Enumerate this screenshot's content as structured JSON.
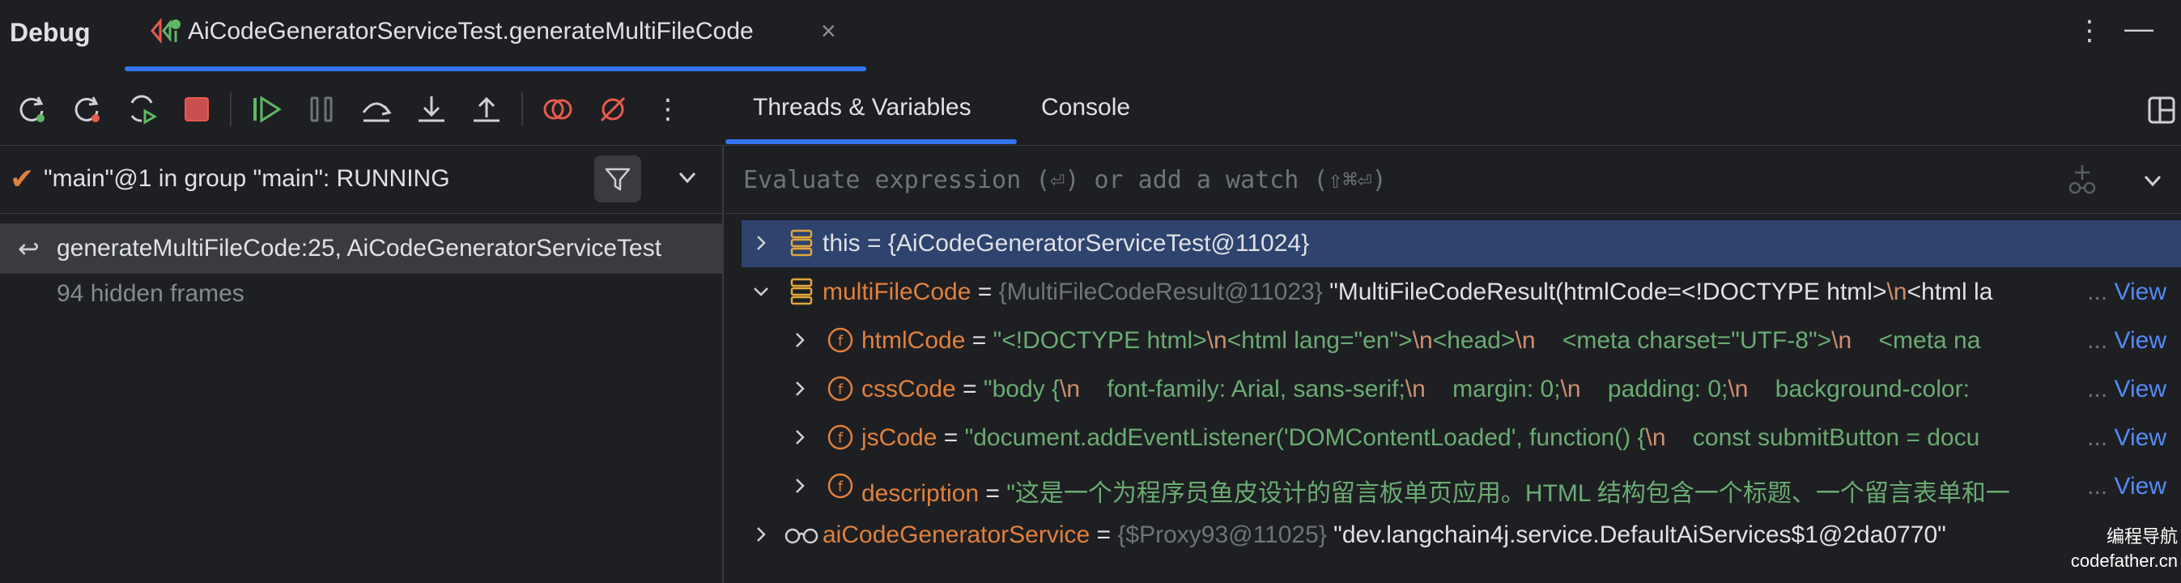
{
  "title": {
    "tool_window": "Debug",
    "run_tab_label": "AiCodeGeneratorServiceTest.generateMultiFileCode",
    "run_tab_close": "×",
    "more_glyph": "⋮",
    "minimize_glyph": "—"
  },
  "toolbar": {
    "more_glyph": "⋮"
  },
  "right_tabs": [
    {
      "label": "Threads & Variables",
      "active": true
    },
    {
      "label": "Console",
      "active": false
    }
  ],
  "thread": {
    "label": "\"main\"@1 in group \"main\": RUNNING"
  },
  "frames": {
    "current": "generateMultiFileCode:25, AiCodeGeneratorServiceTest",
    "hidden": "94 hidden frames"
  },
  "evaluate": {
    "placeholder": "Evaluate expression (⏎) or add a watch (⇧⌘⏎)"
  },
  "variables": {
    "this_row": {
      "name": "this",
      "equals": " = ",
      "value": "{AiCodeGeneratorServiceTest@11024}"
    },
    "multi_row": {
      "name": "multiFileCode",
      "equals": " = ",
      "type": "{MultiFileCodeResult@11023}",
      "v1": " \"MultiFileCodeResult(htmlCode=<!DOCTYPE html>",
      "e1": "\\n",
      "v2": "<html la",
      "ellipsis": "...",
      "view": "View"
    },
    "html_row": {
      "name": "htmlCode",
      "equals": " = ",
      "v1": "\"<!DOCTYPE html>",
      "e1": "\\n",
      "v2": "<html lang=\"en\">",
      "e2": "\\n",
      "v3": "<head>",
      "e3": "\\n",
      "v4": "    <meta charset=\"UTF-8\">",
      "e4": "\\n",
      "v5": "    <meta na",
      "ellipsis": "...",
      "view": "View"
    },
    "css_row": {
      "name": "cssCode",
      "equals": " = ",
      "v1": "\"body {",
      "e1": "\\n",
      "v2": "    font-family: Arial, sans-serif;",
      "e2": "\\n",
      "v3": "    margin: 0;",
      "e3": "\\n",
      "v4": "    padding: 0;",
      "e4": "\\n",
      "v5": "    background-color: ",
      "ellipsis": "...",
      "view": "View"
    },
    "js_row": {
      "name": "jsCode",
      "equals": " = ",
      "v1": "\"document.addEventListener('DOMContentLoaded', function() {",
      "e1": "\\n",
      "v2": "    const submitButton = docu",
      "ellipsis": "...",
      "view": "View"
    },
    "desc_row": {
      "name": "description",
      "equals": " = ",
      "v1": "\"这是一个为程序员鱼皮设计的留言板单页应用。HTML 结构包含一个标题、一个留言表单和一",
      "ellipsis": "...",
      "view": "View"
    },
    "service_row": {
      "name": "aiCodeGeneratorService",
      "equals": " = ",
      "type": "{$Proxy93@11025}",
      "value": " \"dev.langchain4j.service.DefaultAiServices$1@2da0770\""
    }
  },
  "watermark": {
    "line1": "编程导航",
    "line2": "codefather.cn"
  },
  "colors": {
    "background": "#1e1f22",
    "accent": "#3574f0",
    "selection": "#2e436e",
    "field_orange": "#e0803c",
    "string_green": "#6aab73",
    "link_blue": "#548af7",
    "stop_red": "#c94f4f",
    "resume_green": "#5fb865"
  }
}
